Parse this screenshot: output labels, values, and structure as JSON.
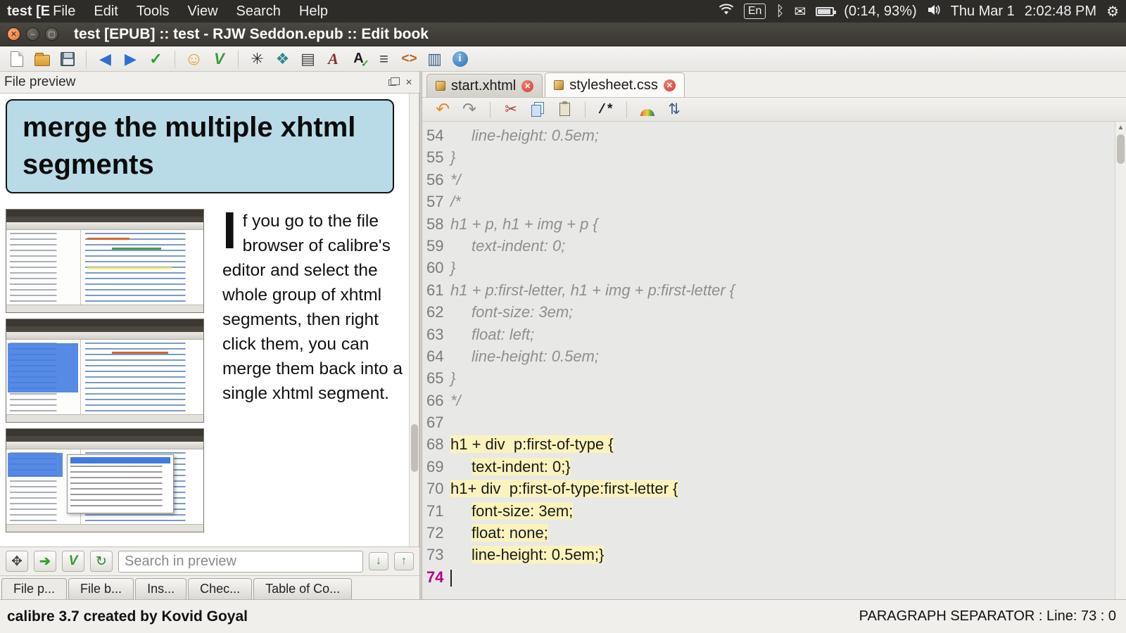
{
  "topbar": {
    "window_hint": "test [E",
    "menus": [
      "File",
      "Edit",
      "Tools",
      "View",
      "Search",
      "Help"
    ],
    "keyboard": "En",
    "battery": "(0:14, 93%)",
    "date": "Thu Mar 1",
    "time": "2:02:48 PM"
  },
  "titlebar": {
    "title": "test [EPUB] :: test - RJW Seddon.epub :: Edit book"
  },
  "left_panel": {
    "title": "File preview",
    "heading": "merge the multiple xhtml segments",
    "dropcap": "I",
    "body_text": "f you go to the file browser of calibre's editor and select the whole group of xhtml segments, then right click them, you can merge them back into a single xhtml segment.",
    "search_placeholder": "Search in preview",
    "tabs": [
      "File p...",
      "File b...",
      "Ins...",
      "Chec...",
      "Table of Co..."
    ]
  },
  "editor": {
    "tabs": [
      {
        "label": "start.xhtml",
        "active": false
      },
      {
        "label": "stylesheet.css",
        "active": true
      }
    ],
    "comment_button": "/*",
    "lines": [
      {
        "n": 54,
        "ind": 1,
        "txt": "line-height: 0.5em;",
        "k": "comment"
      },
      {
        "n": 55,
        "ind": 0,
        "txt": "}",
        "k": "comment"
      },
      {
        "n": 56,
        "ind": 0,
        "txt": "*/",
        "k": "comment"
      },
      {
        "n": 57,
        "ind": 0,
        "txt": "/*",
        "k": "comment"
      },
      {
        "n": 58,
        "ind": 0,
        "txt": "h1 + p, h1 + img + p {",
        "k": "comment"
      },
      {
        "n": 59,
        "ind": 1,
        "txt": "text-indent: 0;",
        "k": "comment"
      },
      {
        "n": 60,
        "ind": 0,
        "txt": "}",
        "k": "comment"
      },
      {
        "n": 61,
        "ind": 0,
        "txt": "h1 + p:first-letter, h1 + img + p:first-letter {",
        "k": "comment"
      },
      {
        "n": 62,
        "ind": 1,
        "txt": "font-size: 3em;",
        "k": "comment"
      },
      {
        "n": 63,
        "ind": 1,
        "txt": "float: left;",
        "k": "comment"
      },
      {
        "n": 64,
        "ind": 1,
        "txt": "line-height: 0.5em;",
        "k": "comment"
      },
      {
        "n": 65,
        "ind": 0,
        "txt": "}",
        "k": "comment"
      },
      {
        "n": 66,
        "ind": 0,
        "txt": "*/",
        "k": "comment"
      },
      {
        "n": 67,
        "ind": 0,
        "txt": "",
        "k": "plain"
      },
      {
        "n": 68,
        "ind": 0,
        "txt": "h1 + div  p:first-of-type {",
        "k": "hl"
      },
      {
        "n": 69,
        "ind": 1,
        "txt": "text-indent: 0;}",
        "k": "hl"
      },
      {
        "n": 70,
        "ind": 0,
        "txt": "h1+ div  p:first-of-type:first-letter {",
        "k": "hl"
      },
      {
        "n": 71,
        "ind": 1,
        "txt": "font-size: 3em;",
        "k": "hl"
      },
      {
        "n": 72,
        "ind": 1,
        "txt": "float: none;",
        "k": "hl"
      },
      {
        "n": 73,
        "ind": 1,
        "txt": "line-height: 0.5em;}",
        "k": "hl"
      },
      {
        "n": 74,
        "ind": 0,
        "txt": "",
        "k": "cursor"
      }
    ]
  },
  "statusbar": {
    "left": "calibre 3.7 created by Kovid Goyal",
    "right": "PARAGRAPH SEPARATOR : Line: 73 : 0"
  },
  "colors": {
    "highlight": "#fbf3bd",
    "comment_text": "#8f8f8f",
    "cursor_line_number": "#b8008a",
    "heading_box_bg": "#b8dbe7"
  },
  "icons": {
    "back": "◀",
    "forward": "▶",
    "check": "✓",
    "smiley": "☺",
    "merge_check": "V",
    "spider": "✳",
    "award": "❖",
    "book": "▤",
    "font_italic": "A",
    "spellcheck": "A",
    "align": "≡",
    "code": "<>",
    "columns": "▥",
    "undo": "↶",
    "redo": "↷",
    "cut": "✂",
    "sort": "⇅",
    "search_tool": "✥",
    "search_go": "➔",
    "search_check": "V",
    "refresh": "↻",
    "down_arrow": "↓",
    "up_arrow": "↑",
    "bluetooth": "ᛒ",
    "mail": "✉",
    "gear": "⚙",
    "close_small": "✕"
  }
}
